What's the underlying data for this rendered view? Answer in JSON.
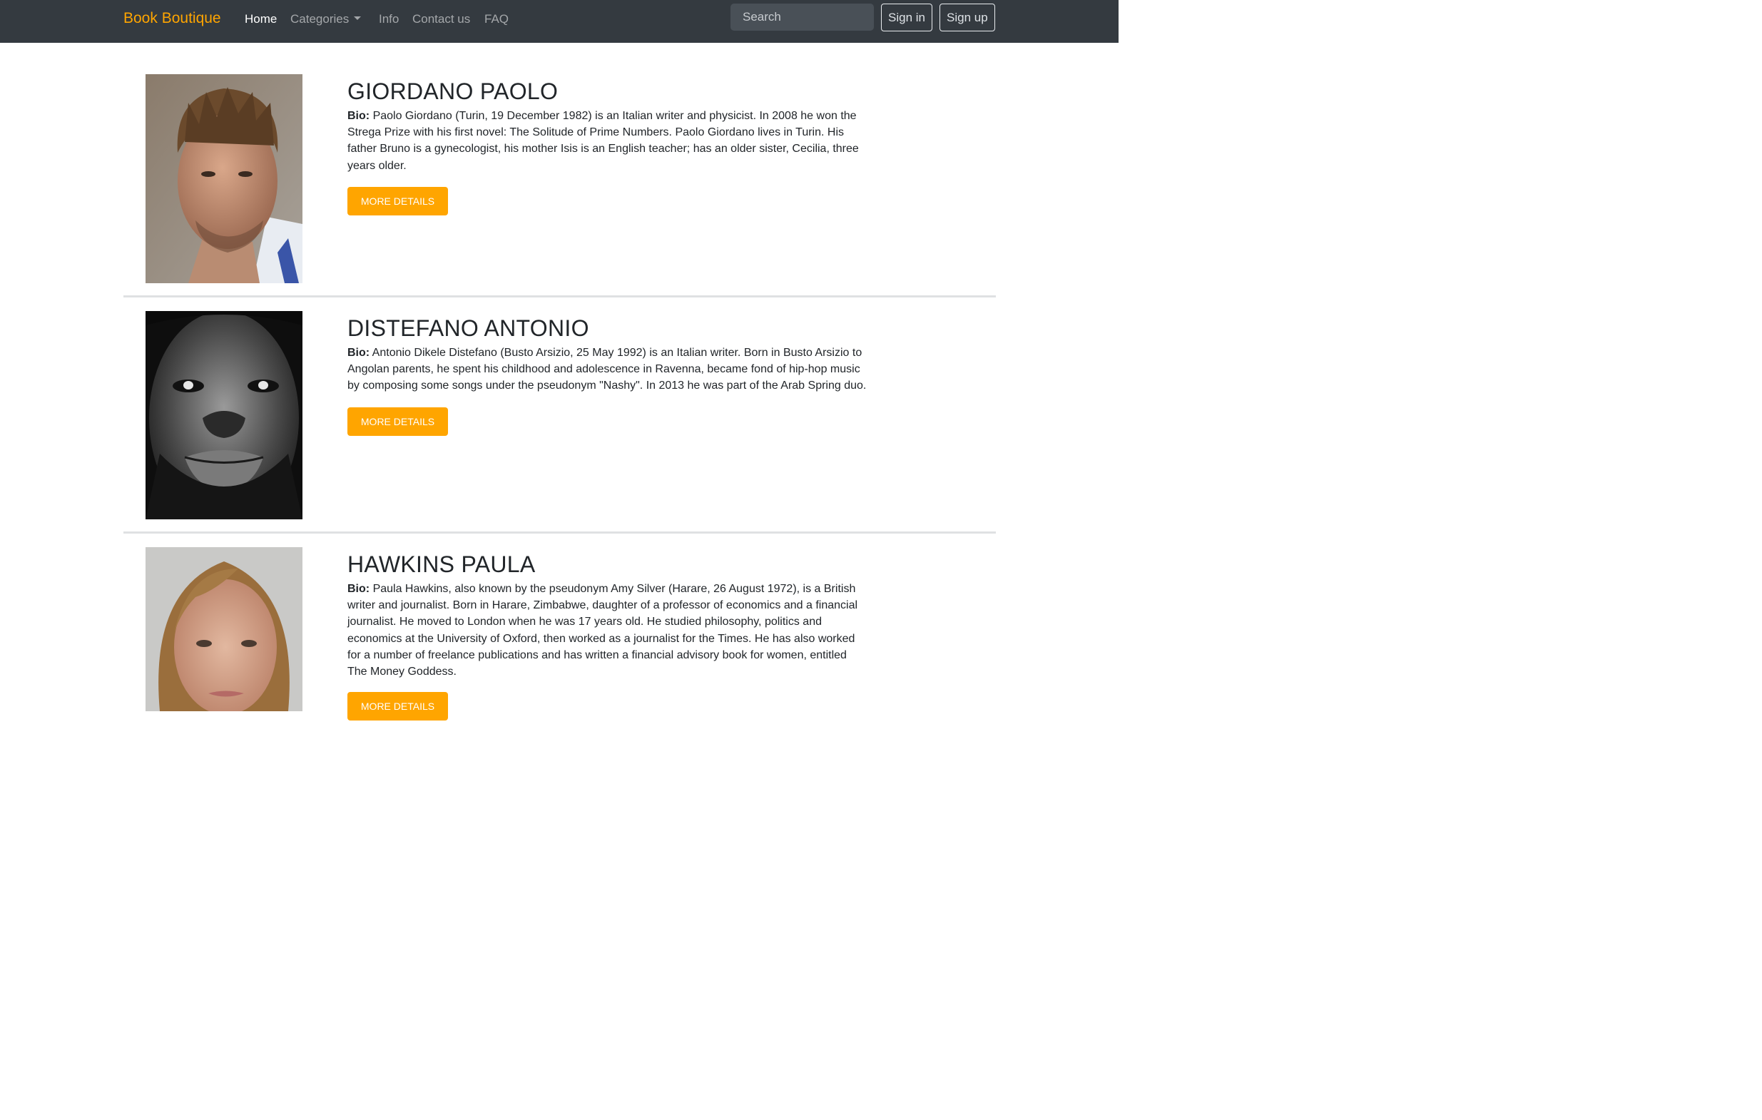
{
  "navbar": {
    "brand": "Book Boutique",
    "links": [
      {
        "label": "Home",
        "active": true
      },
      {
        "label": "Categories",
        "dropdown": true
      },
      {
        "label": "Info"
      },
      {
        "label": "Contact us"
      },
      {
        "label": "FAQ"
      }
    ],
    "search_placeholder": "Search",
    "sign_in": "Sign in",
    "sign_up": "Sign up"
  },
  "colors": {
    "navbar_bg": "#343a40",
    "brand": "#ffa500",
    "button": "#ffa500"
  },
  "authors": [
    {
      "name": "GIORDANO PAOLO",
      "bio_label": "Bio:",
      "bio": "Paolo Giordano (Turin, 19 December 1982) is an Italian writer and physicist. In 2008 he won the Strega Prize with his first novel: The Solitude of Prime Numbers. Paolo Giordano lives in Turin. His father Bruno is a gynecologist, his mother Isis is an English teacher; has an older sister, Cecilia, three years older.",
      "button": "More details",
      "photo": "author-photo-giordano"
    },
    {
      "name": "DISTEFANO ANTONIO",
      "bio_label": "Bio:",
      "bio": "Antonio Dikele Distefano (Busto Arsizio, 25 May 1992) is an Italian writer. Born in Busto Arsizio to Angolan parents, he spent his childhood and adolescence in Ravenna, became fond of hip-hop music by composing some songs under the pseudonym \"Nashy\". In 2013 he was part of the Arab Spring duo.",
      "button": "More details",
      "photo": "author-photo-distefano"
    },
    {
      "name": "HAWKINS PAULA",
      "bio_label": "Bio:",
      "bio": "Paula Hawkins, also known by the pseudonym Amy Silver (Harare, 26 August 1972), is a British writer and journalist. Born in Harare, Zimbabwe, daughter of a professor of economics and a financial journalist. He moved to London when he was 17 years old. He studied philosophy, politics and economics at the University of Oxford, then worked as a journalist for the Times. He has also worked for a number of freelance publications and has written a financial advisory book for women, entitled The Money Goddess.",
      "button": "More details",
      "photo": "author-photo-hawkins"
    }
  ]
}
